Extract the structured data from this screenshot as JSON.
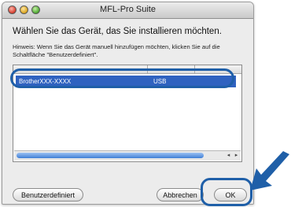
{
  "window": {
    "title": "MFL-Pro Suite"
  },
  "dialog": {
    "heading": "Wählen Sie das Gerät, das Sie installieren möchten.",
    "hint": "Hinweis: Wenn Sie das Gerät manuell hinzufügen möchten, klicken Sie auf die Schaltfläche \"Benutzerdefiniert\"."
  },
  "devices": {
    "rows": [
      {
        "name": "BrotherXXX-XXXX",
        "connection": "USB",
        "selected": true
      }
    ]
  },
  "buttons": {
    "custom": "Benutzerdefiniert",
    "cancel": "Abbrechen",
    "ok": "OK"
  },
  "colors": {
    "highlight": "#1f5fa8",
    "selection": "#2f62c0",
    "arrow": "#1f5fa8"
  }
}
